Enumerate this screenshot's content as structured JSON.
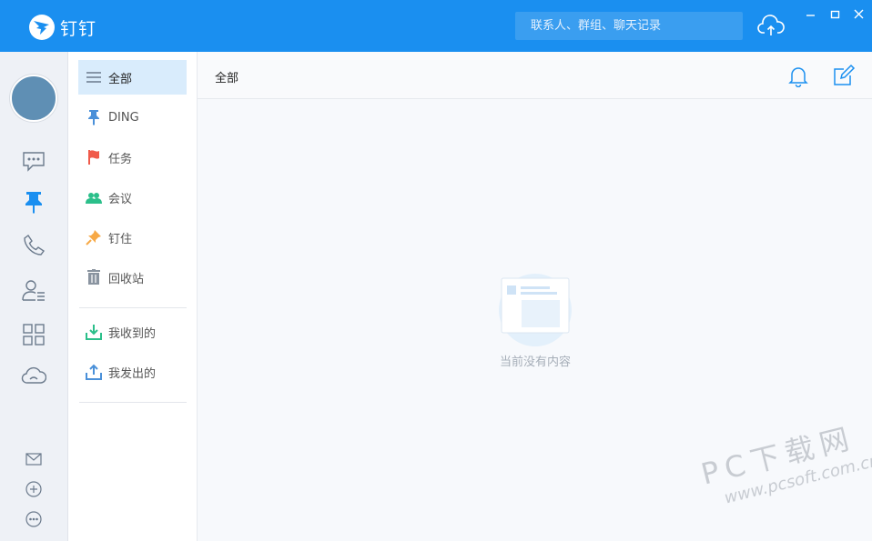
{
  "app": {
    "name": "钉钉"
  },
  "titlebar": {
    "search_placeholder": "联系人、群组、聊天记录"
  },
  "sublist": {
    "items": [
      {
        "label": "全部",
        "icon": "menu-icon",
        "active": true
      },
      {
        "label": "DING",
        "icon": "pin-icon"
      },
      {
        "label": "任务",
        "icon": "flag-icon"
      },
      {
        "label": "会议",
        "icon": "meeting-icon"
      },
      {
        "label": "钉住",
        "icon": "pushpin-icon"
      },
      {
        "label": "回收站",
        "icon": "trash-icon"
      },
      {
        "label": "我收到的",
        "icon": "download-icon"
      },
      {
        "label": "我发出的",
        "icon": "upload-icon"
      }
    ]
  },
  "main": {
    "title": "全部",
    "empty_text": "当前没有内容"
  },
  "watermark": {
    "line1": "PC下载网",
    "line2": "www.pcsoft.com.cn"
  },
  "colors": {
    "brand": "#1a8ff0",
    "active_bg": "#d9ecfc",
    "flag": "#f05a4a",
    "meeting": "#2bbf8a",
    "pushpin": "#f7a946"
  }
}
